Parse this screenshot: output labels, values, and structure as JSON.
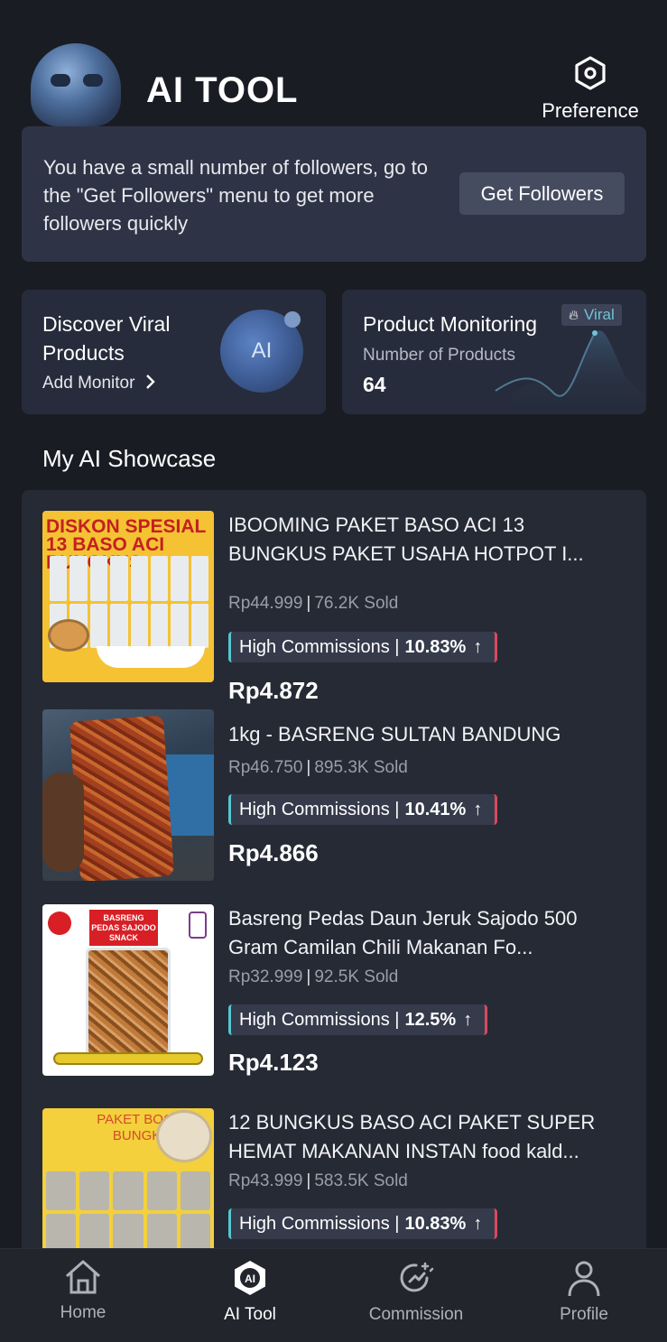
{
  "header": {
    "app_title": "AI TOOL",
    "preference_label": "Preference",
    "preference_icon": "hexagon-gear-icon"
  },
  "follower_notice": {
    "message": "You have a small number of followers, go to the \"Get Followers\" menu to get more followers quickly",
    "button_label": "Get Followers"
  },
  "discover_card": {
    "title": "Discover Viral Products",
    "link_label": "Add Monitor",
    "orb_label": "AI"
  },
  "monitoring_card": {
    "title": "Product Monitoring",
    "badge": "Viral",
    "subtitle": "Number of Products",
    "count": "64"
  },
  "showcase": {
    "title": "My AI Showcase",
    "products": [
      {
        "name": "IBOOMING PAKET BASO ACI 13 BUNGKUS PAKET USAHA HOTPOT I...",
        "price": "Rp44.999",
        "sold": "76.2K Sold",
        "commission_label": "High Commissions |",
        "commission_rate": "10.83%",
        "earning": "Rp4.872",
        "thumb_text": "DISKON SPESIAL 13 BASO ACI BUNGKUS"
      },
      {
        "name": "1kg - BASRENG SULTAN BANDUNG",
        "price": "Rp46.750",
        "sold": "895.3K Sold",
        "commission_label": "High Commissions |",
        "commission_rate": "10.41%",
        "earning": "Rp4.866"
      },
      {
        "name": "Basreng Pedas  Daun Jeruk Sajodo 500 Gram Camilan Chili Makanan  Fo...",
        "price": "Rp32.999",
        "sold": "92.5K Sold",
        "commission_label": "High Commissions |",
        "commission_rate": "12.5%",
        "earning": "Rp4.123",
        "thumb_text": "BASRENG PEDAS SAJODO SNACK"
      },
      {
        "name": "12 BUNGKUS BASO ACI PAKET SUPER HEMAT MAKANAN INSTAN food kald...",
        "price": "Rp43.999",
        "sold": "583.5K Sold",
        "commission_label": "High Commissions |",
        "commission_rate": "10.83%",
        "thumb_text": "PAKET BOCI 12 BUNGKUS"
      }
    ]
  },
  "bottom_nav": [
    {
      "label": "Home",
      "icon": "home-icon",
      "active": false
    },
    {
      "label": "AI Tool",
      "icon": "ai-tool-icon",
      "active": true
    },
    {
      "label": "Commission",
      "icon": "commission-icon",
      "active": false
    },
    {
      "label": "Profile",
      "icon": "profile-icon",
      "active": false
    }
  ],
  "colors": {
    "background": "#1a1c24",
    "card": "#2e3446",
    "accent_cyan": "#55c6d2",
    "accent_red": "#d84a5e"
  }
}
